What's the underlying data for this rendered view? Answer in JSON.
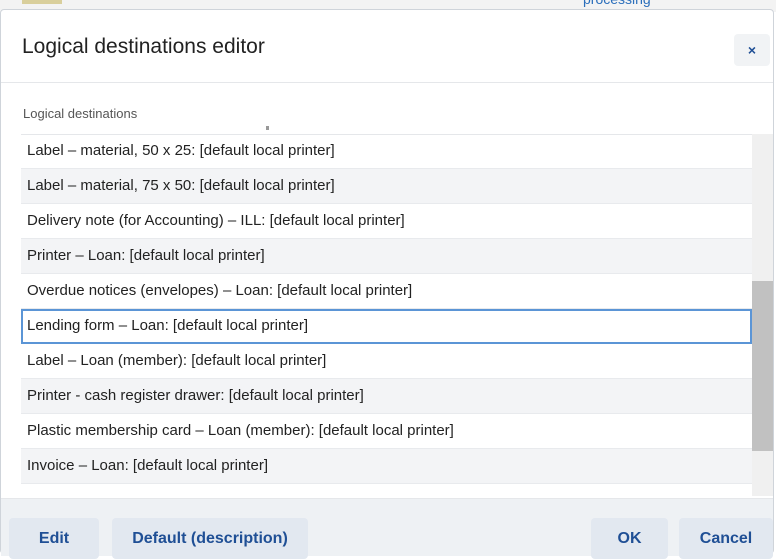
{
  "background": {
    "partial_text": "processing"
  },
  "dialog": {
    "title": "Logical destinations editor",
    "close_icon": "close-icon",
    "close_glyph": "×"
  },
  "list": {
    "label": "Logical destinations",
    "items": [
      {
        "text": "Label – material, 50 x 25: [default local printer]",
        "selected": false
      },
      {
        "text": "Label – material, 75 x 50: [default local printer]",
        "selected": false
      },
      {
        "text": "Delivery note (for Accounting) – ILL: [default local printer]",
        "selected": false
      },
      {
        "text": "Printer – Loan: [default local printer]",
        "selected": false
      },
      {
        "text": "Overdue notices (envelopes) – Loan: [default local printer]",
        "selected": false
      },
      {
        "text": "Lending form – Loan: [default local printer]",
        "selected": true
      },
      {
        "text": "Label – Loan (member): [default local printer]",
        "selected": false
      },
      {
        "text": "Printer - cash register drawer: [default local printer]",
        "selected": false
      },
      {
        "text": "Plastic membership card – Loan (member): [default local printer]",
        "selected": false
      },
      {
        "text": "Invoice – Loan: [default local printer]",
        "selected": false
      }
    ]
  },
  "footer": {
    "edit_label": "Edit",
    "default_label": "Default (description)",
    "ok_label": "OK",
    "cancel_label": "Cancel"
  },
  "colors": {
    "accent": "#1f4f95",
    "selection_border": "#5b95d6",
    "row_alt": "#f3f4f6",
    "footer_bg": "#eef1f4"
  }
}
